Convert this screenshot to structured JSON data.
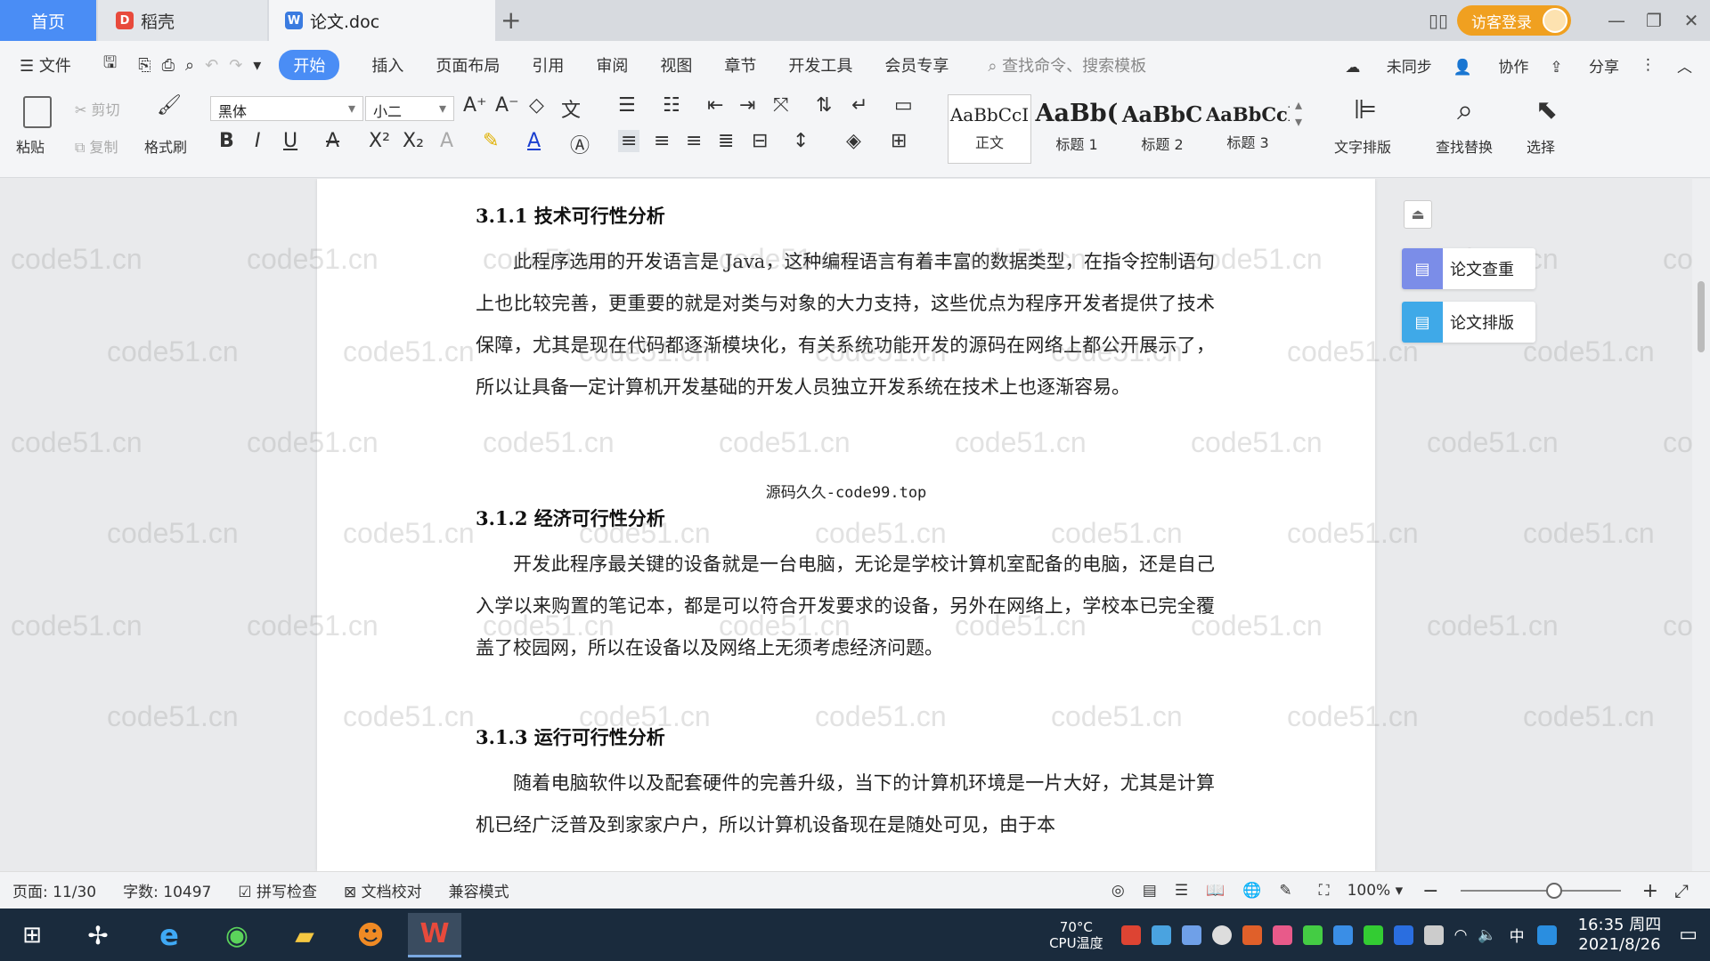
{
  "tabs": {
    "home": "首页",
    "daoke": "稻壳",
    "doc": "论文.doc",
    "plus": "+"
  },
  "window": {
    "login": "访客登录"
  },
  "menu": {
    "file": "文件",
    "items": [
      "开始",
      "插入",
      "页面布局",
      "引用",
      "审阅",
      "视图",
      "章节",
      "开发工具",
      "会员专享"
    ],
    "search_placeholder": "查找命令、搜索模板",
    "sync": "未同步",
    "collab": "协作",
    "share": "分享"
  },
  "ribbon": {
    "paste": "粘贴",
    "cut": "剪切",
    "copy": "复制",
    "format_painter": "格式刷",
    "font_name": "黑体",
    "font_size": "小二",
    "styles": [
      {
        "sample": "AaBbCcI",
        "name": "正文"
      },
      {
        "sample": "AaBb(",
        "name": "标题 1"
      },
      {
        "sample": "AaBbC",
        "name": "标题 2"
      },
      {
        "sample": "AaBbCcl",
        "name": "标题 3"
      }
    ],
    "text_layout": "文字排版",
    "find_replace": "查找替换",
    "select": "选择"
  },
  "document": {
    "sections": [
      {
        "heading": "3.1.1  技术可行性分析",
        "paragraph": "此程序选用的开发语言是 Java，这种编程语言有着丰富的数据类型，在指令控制语句上也比较完善，更重要的就是对类与对象的大力支持，这些优点为程序开发者提供了技术保障，尤其是现在代码都逐渐模块化，有关系统功能开发的源码在网络上都公开展示了，所以让具备一定计算机开发基础的开发人员独立开发系统在技术上也逐渐容易。"
      },
      {
        "heading": "3.1.2  经济可行性分析",
        "paragraph": "开发此程序最关键的设备就是一台电脑，无论是学校计算机室配备的电脑，还是自己入学以来购置的笔记本，都是可以符合开发要求的设备，另外在网络上，学校本已完全覆盖了校园网，所以在设备以及网络上无须考虑经济问题。"
      },
      {
        "heading": "3.1.3  运行可行性分析",
        "paragraph": "随着电脑软件以及配套硬件的完善升级，当下的计算机环境是一片大好，尤其是计算机已经广泛普及到家家户户，所以计算机设备现在是随处可见，由于本"
      }
    ],
    "center_note": "源码久久-code99.top",
    "watermark": "code51.cn"
  },
  "side_panel": {
    "check": "论文查重",
    "layout": "论文排版"
  },
  "status": {
    "page": "页面: 11/30",
    "words": "字数: 10497",
    "spell": "拼写检查",
    "proof": "文档校对",
    "compat": "兼容模式",
    "zoom": "100%",
    "zoom_level": 0.5
  },
  "taskbar": {
    "temp": "70°C",
    "temp_label": "CPU温度",
    "ime": "中",
    "time": "16:35 周四",
    "date": "2021/8/26"
  },
  "colors": {
    "accent": "#4a8df5",
    "login": "#f0a020",
    "taskbar": "#1a2b3d"
  }
}
